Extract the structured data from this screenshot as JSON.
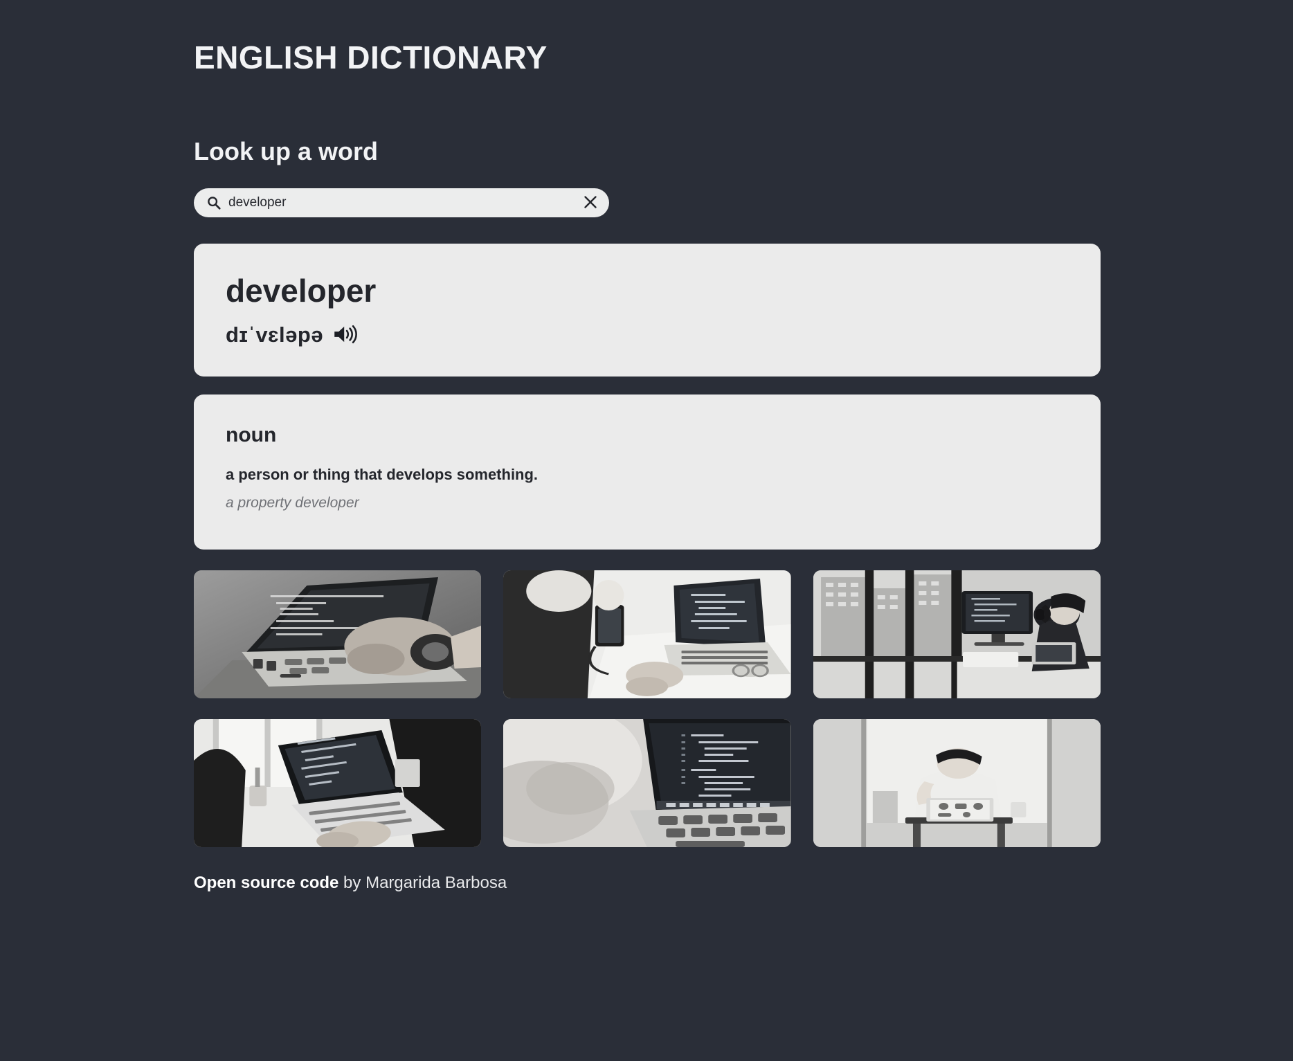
{
  "app": {
    "title": "ENGLISH DICTIONARY",
    "background_color": "#2a2e38",
    "card_color": "#ebebeb",
    "text_color": "#24262c"
  },
  "search": {
    "heading": "Look up a word",
    "value": "developer",
    "placeholder": "",
    "search_icon": "search-icon",
    "clear_icon": "close-icon"
  },
  "word": {
    "term": "developer",
    "phonetic": "dɪˈvɛləpə",
    "audio_icon": "speaker-icon"
  },
  "meanings": [
    {
      "part_of_speech": "noun",
      "definition": "a person or thing that develops something.",
      "example": "a property developer"
    }
  ],
  "photos": [
    {
      "alt": "hands typing on laptop with code on screen"
    },
    {
      "alt": "laptop with code, coffee cup and phone on white desk"
    },
    {
      "alt": "developer with headphones at multi-monitor desk by city window"
    },
    {
      "alt": "person typing on laptop near bright window"
    },
    {
      "alt": "close up of laptop screen showing code"
    },
    {
      "alt": "person working on laptop at desk in bright room"
    }
  ],
  "footer": {
    "link_label": "Open source code",
    "author_text": " by Margarida Barbosa"
  }
}
